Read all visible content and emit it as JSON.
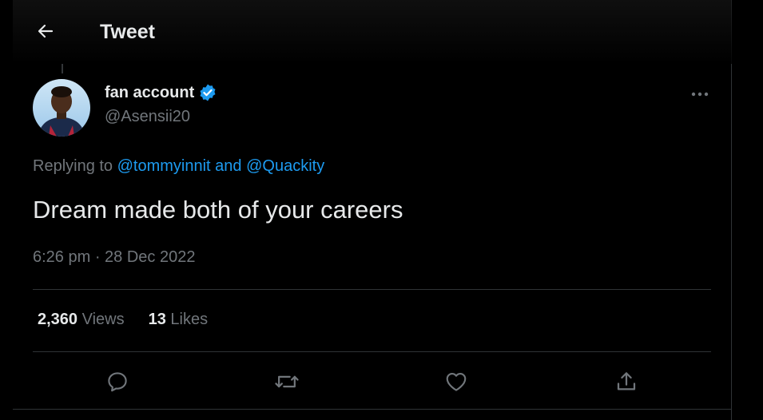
{
  "header": {
    "title": "Tweet"
  },
  "tweet": {
    "author_name": "fan account",
    "author_handle": "@Asensii20",
    "replying_prefix": "Replying to ",
    "mention_1": "@tommyinnit",
    "mention_joiner": " and ",
    "mention_2": "@Quackity",
    "text": "Dream made both of your careers",
    "time": "6:26 pm",
    "separator": " · ",
    "date": "28 Dec 2022"
  },
  "stats": {
    "views_count": "2,360",
    "views_label": " Views",
    "likes_count": "13",
    "likes_label": " Likes"
  },
  "colors": {
    "background": "#000000",
    "text_primary": "#e7e9ea",
    "text_secondary": "#71767b",
    "accent": "#1d9bf0",
    "divider": "#2f3336"
  },
  "icons": {
    "back": "arrow-left-icon",
    "verified": "verified-badge-icon",
    "more": "more-horizontal-icon",
    "reply": "reply-icon",
    "retweet": "retweet-icon",
    "like": "heart-icon",
    "share": "share-icon"
  }
}
